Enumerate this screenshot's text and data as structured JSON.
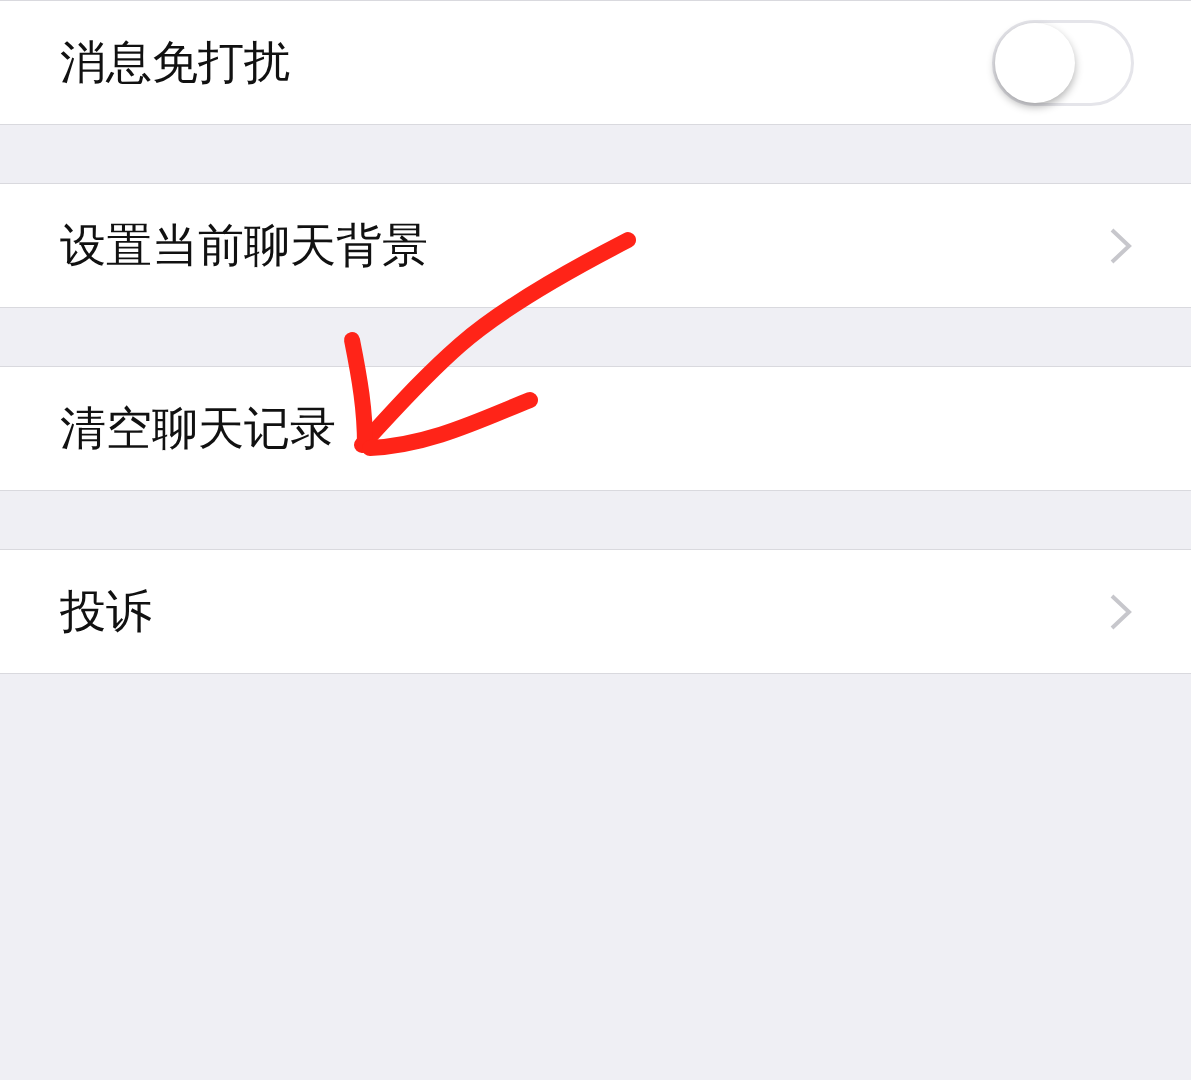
{
  "settings": [
    {
      "kind": "toggle",
      "label": "消息免打扰",
      "on": false
    },
    {
      "kind": "chevron",
      "label": "设置当前聊天背景"
    },
    {
      "kind": "plain",
      "label": "清空聊天记录"
    },
    {
      "kind": "chevron",
      "label": "投诉"
    }
  ],
  "annotation": {
    "kind": "arrow"
  }
}
